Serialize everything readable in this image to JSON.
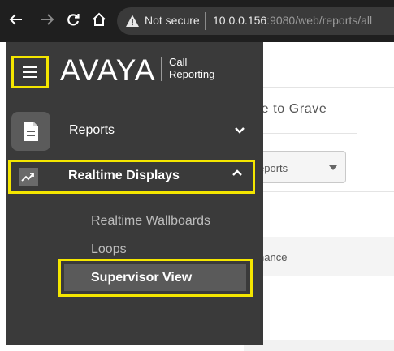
{
  "browser": {
    "not_secure_label": "Not secure",
    "url_host": "10.0.0.156",
    "url_rest": ":9080/web/reports/all"
  },
  "background": {
    "tab_text": "dle to Grave",
    "select_text": "eports",
    "row_text": "nance"
  },
  "sidebar": {
    "logo_text": "AVAYA",
    "logo_sub_line1": "Call",
    "logo_sub_line2": "Reporting",
    "items": [
      {
        "label": "Reports",
        "icon": "document-icon",
        "state": "collapsed"
      },
      {
        "label": "Realtime Displays",
        "icon": "trending-up-icon",
        "state": "expanded"
      }
    ],
    "subitems": [
      {
        "label": "Realtime Wallboards"
      },
      {
        "label": "Loops"
      },
      {
        "label": "Supervisor View",
        "selected": true
      }
    ]
  },
  "colors": {
    "toolbar_bg": "#1f1f1f",
    "sidebar_bg": "#3a3a3a",
    "highlight": "#f4e600",
    "selected_bg": "#5a5a5a"
  }
}
